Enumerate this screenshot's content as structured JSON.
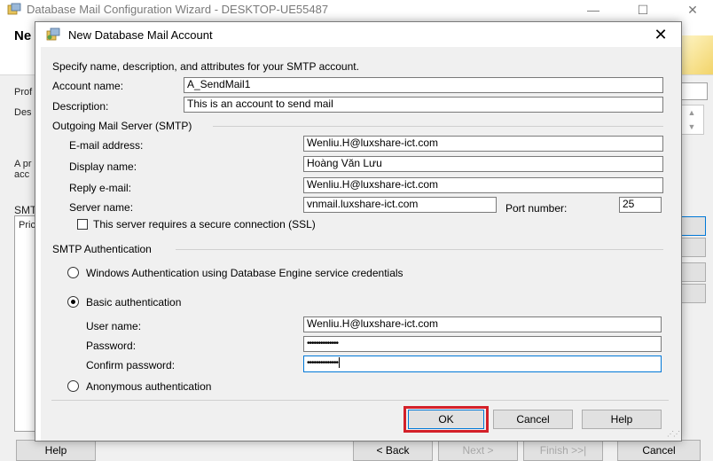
{
  "background_window": {
    "title": "Database Mail Configuration Wizard - DESKTOP-UE55487",
    "controls": {
      "minimize": "—",
      "maximize": "☐",
      "close": "✕"
    },
    "header_title": "Ne",
    "labels": {
      "profile": "Prof",
      "description": "Des",
      "info_line1": "A pr",
      "info_line2": "acc",
      "smtp": "SMT",
      "priority": "Pric"
    },
    "buttons": {
      "help": "Help",
      "back": "< Back",
      "next": "Next >",
      "finish": "Finish >>|",
      "cancel": "Cancel"
    }
  },
  "dialog": {
    "title": "New Database Mail Account",
    "close_glyph": "✕",
    "intro": "Specify name, description, and attributes for your SMTP account.",
    "account_name": {
      "label": "Account name:",
      "value": "A_SendMail1"
    },
    "description": {
      "label": "Description:",
      "value": "This is an account to send mail"
    },
    "outgoing_group": "Outgoing Mail Server (SMTP)",
    "email_address": {
      "label": "E-mail address:",
      "value": "Wenliu.H@luxshare-ict.com"
    },
    "display_name": {
      "label": "Display name:",
      "value": "Hoàng Văn Lưu"
    },
    "reply_email": {
      "label": "Reply e-mail:",
      "value": "Wenliu.H@luxshare-ict.com"
    },
    "server_name": {
      "label": "Server name:",
      "value": "vnmail.luxshare-ict.com"
    },
    "port_number": {
      "label": "Port number:",
      "value": "25"
    },
    "ssl": {
      "label": "This server requires a secure connection (SSL)",
      "checked": false
    },
    "auth_group": "SMTP Authentication",
    "auth_windows": {
      "label": "Windows Authentication using Database Engine service credentials",
      "selected": false
    },
    "auth_basic": {
      "label": "Basic authentication",
      "selected": true
    },
    "user_name": {
      "label": "User name:",
      "value": "Wenliu.H@luxshare-ict.com"
    },
    "password": {
      "label": "Password:",
      "value": "••••••••••••••"
    },
    "confirm_password": {
      "label": "Confirm password:",
      "value": "••••••••••••••"
    },
    "auth_anonymous": {
      "label": "Anonymous authentication",
      "selected": false
    },
    "buttons": {
      "ok": "OK",
      "cancel": "Cancel",
      "help": "Help"
    },
    "highlight_color": "#d32029",
    "focus_color": "#0078d7"
  }
}
